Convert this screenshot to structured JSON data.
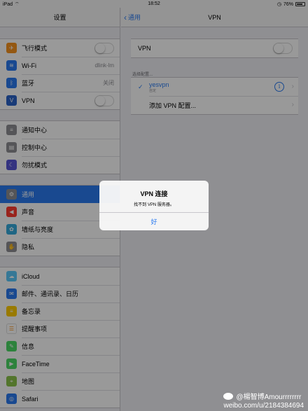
{
  "status_bar": {
    "device": "iPad",
    "time": "18:52",
    "battery": "76%"
  },
  "left": {
    "title": "设置",
    "groups": [
      [
        {
          "label": "飞行模式",
          "icon": "airplane-icon",
          "color": "#f7931e",
          "toggle": true
        },
        {
          "label": "Wi-Fi",
          "icon": "wifi-icon",
          "color": "#2b7bf0",
          "value": "dlink-lm"
        },
        {
          "label": "蓝牙",
          "icon": "bluetooth-icon",
          "color": "#2b7bf0",
          "value": "关闭"
        },
        {
          "label": "VPN",
          "icon": "vpn-icon",
          "color": "#2b63c9",
          "toggle": true
        }
      ],
      [
        {
          "label": "通知中心",
          "icon": "notification-icon",
          "color": "#8e8e93"
        },
        {
          "label": "控制中心",
          "icon": "control-center-icon",
          "color": "#8e8e93"
        },
        {
          "label": "勿扰模式",
          "icon": "moon-icon",
          "color": "#5856d6"
        }
      ],
      [
        {
          "label": "通用",
          "icon": "gear-icon",
          "color": "#8e8e93",
          "selected": true
        },
        {
          "label": "声音",
          "icon": "speaker-icon",
          "color": "#ff3b30"
        },
        {
          "label": "墙纸与亮度",
          "icon": "wallpaper-icon",
          "color": "#34aadc"
        },
        {
          "label": "隐私",
          "icon": "hand-icon",
          "color": "#8e8e93"
        }
      ],
      [
        {
          "label": "iCloud",
          "icon": "icloud-icon",
          "color": "#5ac8fa"
        },
        {
          "label": "邮件、通讯录、日历",
          "icon": "mail-icon",
          "color": "#2b7bf0"
        },
        {
          "label": "备忘录",
          "icon": "notes-icon",
          "color": "#ffcc00"
        },
        {
          "label": "提醒事项",
          "icon": "reminders-icon",
          "color": "#ffffff"
        },
        {
          "label": "信息",
          "icon": "messages-icon",
          "color": "#4cd964"
        },
        {
          "label": "FaceTime",
          "icon": "facetime-icon",
          "color": "#4cd964"
        },
        {
          "label": "地图",
          "icon": "maps-icon",
          "color": "#8bc34a"
        },
        {
          "label": "Safari",
          "icon": "safari-icon",
          "color": "#2b7bf0"
        }
      ]
    ]
  },
  "right": {
    "back_label": "通用",
    "title": "VPN",
    "vpn_label": "VPN",
    "section_caption": "选择配置...",
    "vpn_config": {
      "name": "yesvpn",
      "sub": "自定"
    },
    "add_label": "添加 VPN 配置..."
  },
  "alert": {
    "title": "VPN 连接",
    "message": "找不到 VPN 服务器。",
    "button": "好"
  },
  "watermark": {
    "line1": "@楊智博Amourrrrrrrr",
    "line2": "weibo.com/u/2184384694"
  },
  "colors": {
    "accent": "#2b7bf0",
    "overlay": "rgba(0,0,0,0.40)"
  }
}
